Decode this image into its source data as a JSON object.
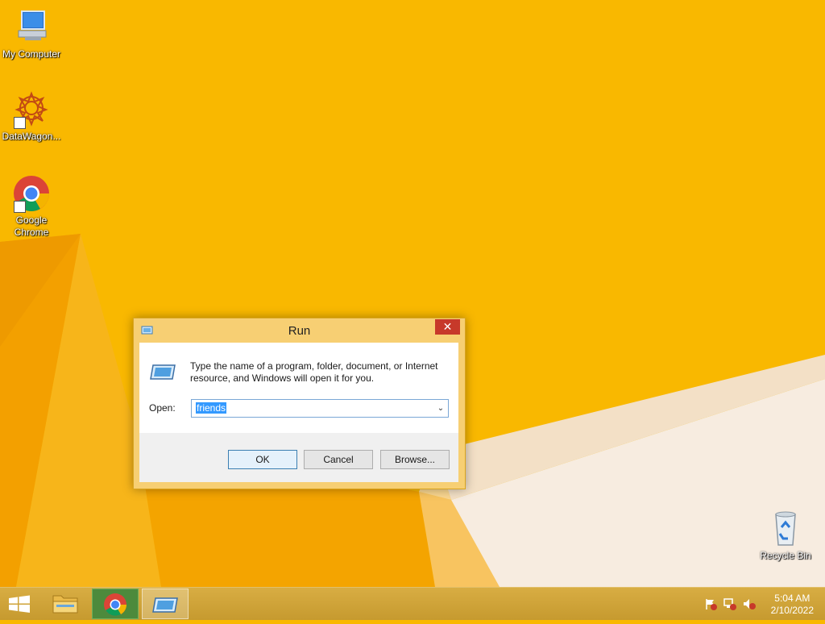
{
  "desktop": {
    "icons": [
      {
        "label": "My Computer",
        "icon": "computer-icon"
      },
      {
        "label": "DataWagon...",
        "icon": "datawagon-icon"
      },
      {
        "label": "Google Chrome",
        "icon": "chrome-icon"
      },
      {
        "label": "Recycle Bin",
        "icon": "recycle-bin-icon"
      }
    ]
  },
  "run_dialog": {
    "title": "Run",
    "close_glyph": "✕",
    "description": "Type the name of a program, folder, document, or Internet resource, and Windows will open it for you.",
    "open_label": "Open:",
    "open_value": "friends",
    "dropdown_glyph": "⌄",
    "buttons": {
      "ok": "OK",
      "cancel": "Cancel",
      "browse": "Browse..."
    }
  },
  "taskbar": {
    "items": [
      "start-button",
      "file-explorer",
      "google-chrome",
      "run-dialog"
    ],
    "tray_icons": [
      "action-center-flag-icon",
      "network-icon",
      "volume-muted-icon"
    ],
    "clock": {
      "time": "5:04 AM",
      "date": "2/10/2022"
    }
  },
  "colors": {
    "wallpaper": "#f9b800",
    "taskbar": "#d1a63d",
    "dialog_frame": "#f7cf73",
    "close_button": "#c7392a",
    "selection": "#3399ff"
  }
}
